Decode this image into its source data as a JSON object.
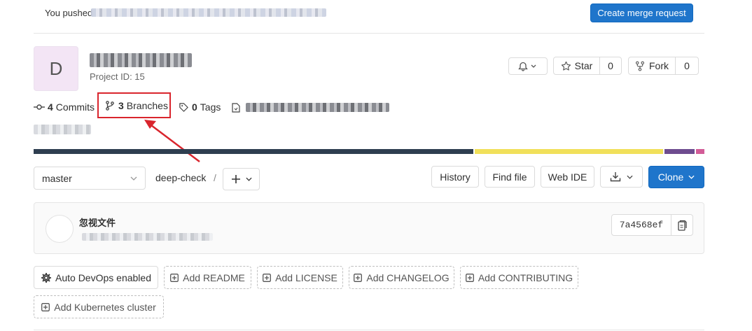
{
  "alert": {
    "text": "You pushed",
    "action_label": "Create merge request"
  },
  "project": {
    "avatar_letter": "D",
    "id_text": "Project ID: 15"
  },
  "actions": {
    "star_label": "Star",
    "star_count": "0",
    "fork_label": "Fork",
    "fork_count": "0"
  },
  "stats": {
    "commits_count": "4",
    "commits_label": "Commits",
    "branches_count": "3",
    "branches_label": "Branches",
    "tags_count": "0",
    "tags_label": "Tags"
  },
  "language_bar": [
    {
      "color": "#2e3e50",
      "fraction": 0.573
    },
    {
      "color": "#f1e05a",
      "fraction": 0.245
    },
    {
      "color": "#6e4c8f",
      "fraction": 0.039
    },
    {
      "color": "#d25c97",
      "fraction": 0.011
    }
  ],
  "repo": {
    "branch": "master",
    "path": "deep-check",
    "path_sep": "/",
    "history_label": "History",
    "find_file_label": "Find file",
    "web_ide_label": "Web IDE",
    "clone_label": "Clone"
  },
  "commit": {
    "title": "忽视文件",
    "sha": "7a4568ef"
  },
  "shortcuts": [
    {
      "name": "auto-devops-button",
      "label": "Auto DevOps enabled"
    },
    {
      "name": "add-readme-button",
      "label": "Add README"
    },
    {
      "name": "add-license-button",
      "label": "Add LICENSE"
    },
    {
      "name": "add-changelog-button",
      "label": "Add CHANGELOG"
    },
    {
      "name": "add-contributing-button",
      "label": "Add CONTRIBUTING"
    },
    {
      "name": "add-kubernetes-button",
      "label": "Add Kubernetes cluster"
    }
  ],
  "colors": {
    "primary": "#1f75cb",
    "highlight": "#d9252d"
  }
}
